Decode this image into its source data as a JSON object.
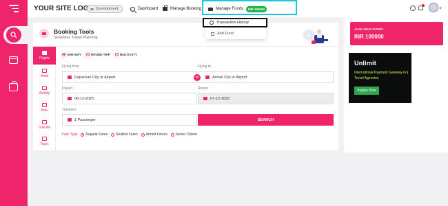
{
  "header": {
    "logo": "YOUR SITE LOGO",
    "env_badge": "Development",
    "nav": {
      "dashboard": "Dashboard",
      "manage_booking": "Manage Booking",
      "manage_funds": "Manage Funds",
      "funds_pill": "INR 100000"
    }
  },
  "funds_dropdown": {
    "items": [
      "Transaction History",
      "Add Fund"
    ],
    "highlight_color": "#19c5e0"
  },
  "booking": {
    "title": "Booking Tools",
    "subtitle": "Seamless Travel Planning",
    "tabs": [
      "Flights",
      "Hotel",
      "Activity",
      "Bus",
      "Transfer",
      "Tours"
    ],
    "active_tab": "Flights",
    "trip_types": [
      "ONE WAY",
      "ROUND TRIP",
      "MULTI-CITY"
    ],
    "selected_trip_type": "ONE WAY",
    "labels": {
      "from": "Flying from",
      "to": "Flying to",
      "depart": "Depart",
      "return": "Return",
      "travelers": "Travelers"
    },
    "from_placeholder": "Departure City or Airport",
    "to_placeholder": "Arrival City or Airport",
    "depart_date": "06-12-2025",
    "return_date": "07-12-2025",
    "passengers": "1 Passenger",
    "search_label": "SEARCH",
    "fare_type_label": "Fare Type",
    "fare_types": [
      "Regular Fares",
      "Student Fares",
      "Armed Forces",
      "Senior Citizen"
    ],
    "selected_fare": "Regular Fares"
  },
  "side": {
    "funds_label": "AVAILABLE FUNDS",
    "funds_value": "INR 100000",
    "ad": {
      "logo": "Unlimit",
      "text": "International Payment Gateway For Travel Agencies",
      "cta": "Inquire Now"
    }
  },
  "colors": {
    "accent": "#f0246a",
    "ad_text": "#d9f25a",
    "ad_button": "#2fa84f",
    "funds_pill": "#1fb34a"
  },
  "icons": [
    "menu-icon",
    "search-icon",
    "wallet-icon",
    "bag-icon",
    "eye-icon",
    "gear-icon",
    "bell-icon",
    "clock-icon",
    "plus-icon",
    "plane-icon",
    "calendar-icon",
    "user-icon",
    "swap-icon"
  ]
}
